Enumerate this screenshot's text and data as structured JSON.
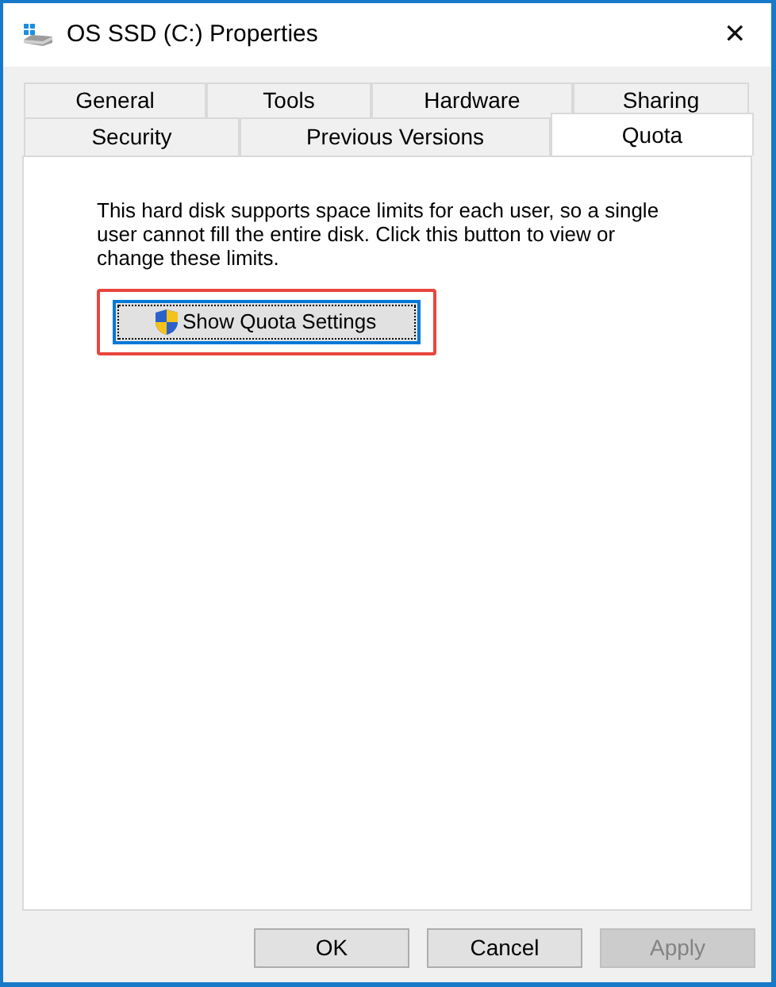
{
  "window": {
    "title": "OS SSD (C:) Properties",
    "close": "✕"
  },
  "tab_rows": [
    {
      "tabs": [
        {
          "label": "General",
          "selected": false
        },
        {
          "label": "Tools",
          "selected": false
        },
        {
          "label": "Hardware",
          "selected": false
        },
        {
          "label": "Sharing",
          "selected": false
        }
      ]
    },
    {
      "tabs": [
        {
          "label": "Security",
          "selected": false
        },
        {
          "label": "Previous Versions",
          "selected": false
        },
        {
          "label": "Quota",
          "selected": true
        }
      ]
    }
  ],
  "description": "This hard disk supports space limits for each user, so a single user cannot fill the entire disk. Click this button to view or change these limits.",
  "action_button": {
    "label": "Show Quota Settings",
    "focused": true,
    "highlighted": true
  },
  "buttons": [
    {
      "label": "OK",
      "disabled": false
    },
    {
      "label": "Cancel",
      "disabled": false
    },
    {
      "label": "Apply",
      "disabled": true
    }
  ]
}
